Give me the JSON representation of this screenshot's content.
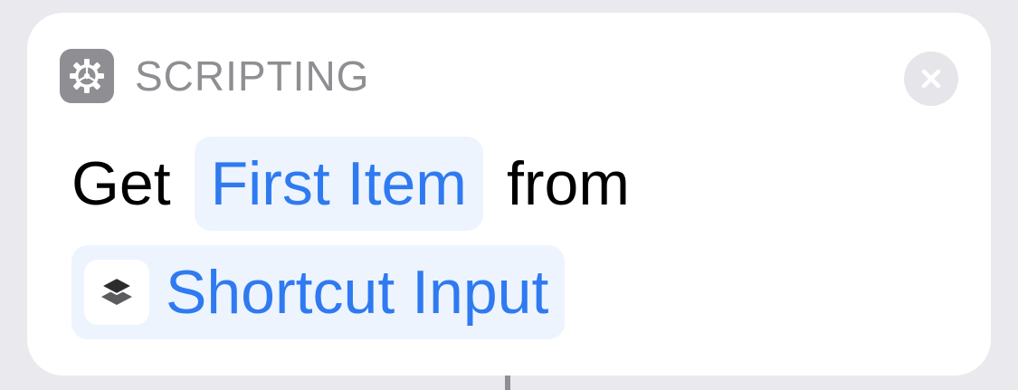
{
  "action": {
    "category": "SCRIPTING",
    "category_icon": "gear-icon",
    "close_icon": "close-icon",
    "text_before": "Get",
    "item_parameter": "First Item",
    "text_middle": "from",
    "input_variable": "Shortcut Input",
    "input_variable_icon": "shortcuts-layers-icon"
  },
  "colors": {
    "accent": "#2f7af0",
    "pill_background": "#edf4fe",
    "category_gray": "#8e8e93",
    "card": "#ffffff",
    "background": "#e9e9ee"
  }
}
